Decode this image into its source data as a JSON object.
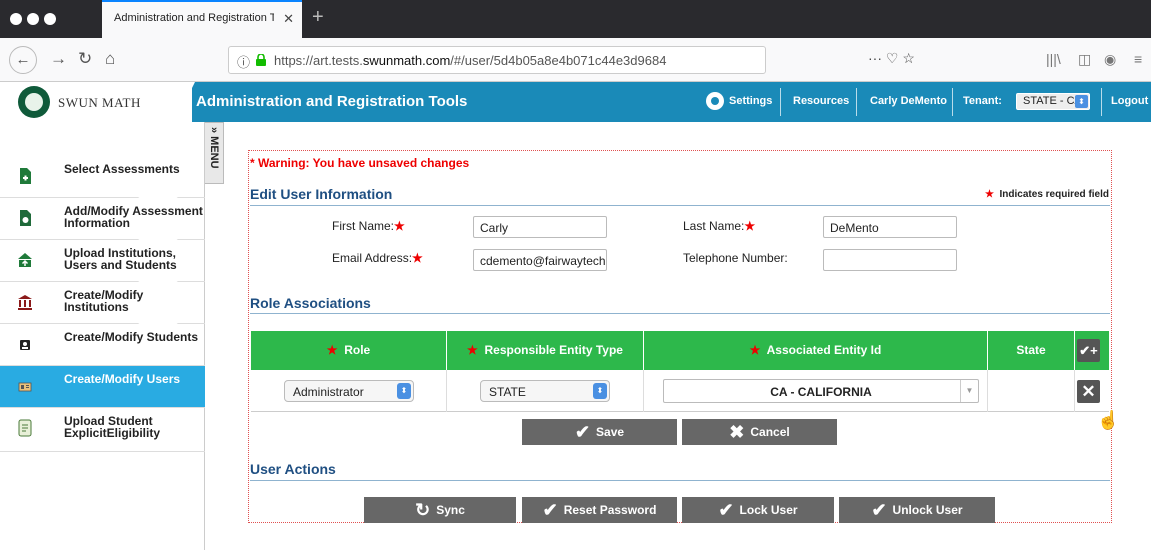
{
  "browser": {
    "tab_title": "Administration and Registration Too",
    "tab_close": "✕",
    "new_tab": "+",
    "url_prefix": "https://art.tests.",
    "url_domain": "swunmath.com",
    "url_path": "/#/user/5d4b05a8e4b071c44e3d9684",
    "nav_back": "←",
    "nav_forward": "→",
    "nav_reload": "↻",
    "nav_home": "⌂",
    "url_info": "ⓘ",
    "url_actions": "···  ♡  ☆",
    "tool_library": "|||\\",
    "tool_sidebar": "◫",
    "tool_account": "◉",
    "tool_menu": "≡"
  },
  "header": {
    "logo_text": "SWUN MATH",
    "app_title": "Administration and Registration Tools",
    "settings_label": "Settings",
    "resources_label": "Resources",
    "user_name": "Carly DeMento",
    "tenant_label": "Tenant:",
    "tenant_value": "STATE - CA",
    "tenant_arrow": "⬍",
    "logout_label": "Logout"
  },
  "sidebar": {
    "menu_toggle": "» MENU",
    "items": [
      {
        "label": "Select Assessments",
        "icon": "document-add-icon"
      },
      {
        "label": "Add/Modify Assessment Information",
        "icon": "document-edit-icon"
      },
      {
        "label": "Upload Institutions, Users and Students",
        "icon": "upload-institution-icon"
      },
      {
        "label": "Create/Modify Institutions",
        "icon": "institution-icon"
      },
      {
        "label": "Create/Modify Students",
        "icon": "student-icon"
      },
      {
        "label": "Create/Modify Users",
        "icon": "users-icon"
      },
      {
        "label": "Upload Student ExplicitEligibility",
        "icon": "upload-eligibility-icon"
      }
    ],
    "active_index": 5
  },
  "main": {
    "warning": "* Warning: You have unsaved changes",
    "edit_title": "Edit User Information",
    "required_note": "Indicates required field",
    "required_star": "★",
    "first_name_label": "First Name:",
    "first_name_value": "Carly",
    "last_name_label": "Last Name:",
    "last_name_value": "DeMento",
    "email_label": "Email Address:",
    "email_value": "cdemento@fairwaytech",
    "phone_label": "Telephone Number:",
    "phone_value": "",
    "role_title": "Role Associations",
    "role_table": {
      "headers": [
        "Role",
        "Responsible Entity Type",
        "Associated Entity Id",
        "State"
      ],
      "add_icon": "✔+",
      "row": {
        "role": "Administrator",
        "entity_type": "STATE",
        "entity_id": "CA - CALIFORNIA",
        "state": "",
        "remove_icon": "✕"
      }
    },
    "save_label": "Save",
    "cancel_label": "Cancel",
    "user_actions_title": "User Actions",
    "sync_label": "Sync",
    "reset_password_label": "Reset Password",
    "lock_label": "Lock User",
    "unlock_label": "Unlock User"
  },
  "colors": {
    "header_blue": "#1a8ab8",
    "table_green": "#2db84b",
    "active_item": "#29abe2",
    "warning_red": "#e00000",
    "section_blue": "#1f4f82"
  }
}
